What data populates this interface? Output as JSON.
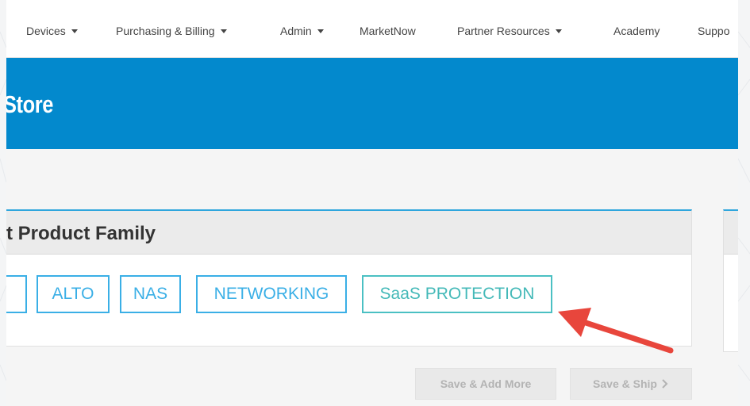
{
  "nav": {
    "items": [
      {
        "label": "Devices",
        "dropdown": true
      },
      {
        "label": "Purchasing & Billing",
        "dropdown": true
      },
      {
        "label": "Admin",
        "dropdown": true
      },
      {
        "label": "MarketNow",
        "dropdown": false
      },
      {
        "label": "Partner Resources",
        "dropdown": true
      },
      {
        "label": "Academy",
        "dropdown": false
      },
      {
        "label": "Suppo",
        "dropdown": false
      }
    ]
  },
  "banner": {
    "title": "Store"
  },
  "panel": {
    "title": "t Product Family",
    "chips": [
      "",
      "ALTO",
      "NAS",
      "NETWORKING",
      "SaaS PROTECTION"
    ]
  },
  "actions": {
    "save_add_more": "Save & Add More",
    "save_ship": "Save & Ship",
    "save_ship_icon": "chevron-right-icon"
  },
  "colors": {
    "banner": "#0389cd",
    "chip_border": "#3aafe6",
    "chip_selected_border": "#4bc0c3",
    "annotation_arrow": "#e8463c"
  }
}
